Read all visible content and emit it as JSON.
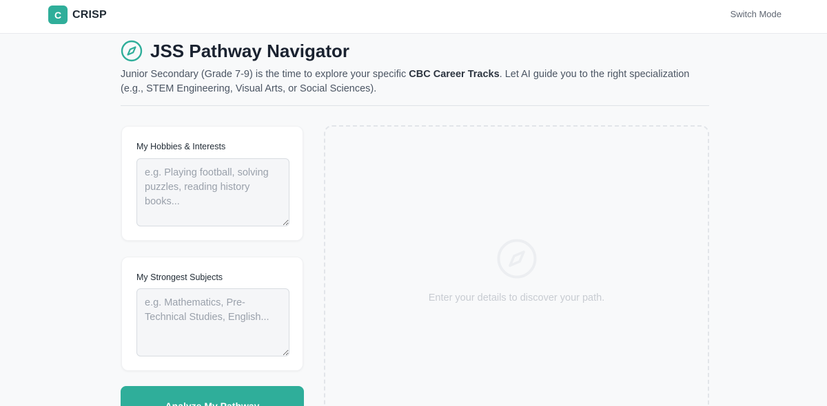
{
  "app": {
    "logo_letter": "C",
    "name": "CRISP",
    "switch_mode_label": "Switch Mode"
  },
  "header": {
    "title": "JSS Pathway Navigator",
    "description_pre": "Junior Secondary (Grade 7-9) is the time to explore your specific ",
    "description_bold": "CBC Career Tracks",
    "description_post": ". Let AI guide you to the right specialization (e.g., STEM Engineering, Visual Arts, or Social Sciences)."
  },
  "form": {
    "hobbies": {
      "label": "My Hobbies & Interests",
      "placeholder": "e.g. Playing football, solving puzzles, reading history books...",
      "value": ""
    },
    "subjects": {
      "label": "My Strongest Subjects",
      "placeholder": "e.g. Mathematics, Pre-Technical Studies, English...",
      "value": ""
    },
    "submit_label": "Analyze My Pathway"
  },
  "result": {
    "empty_icon": "compass-icon",
    "empty_text": "Enter your details to discover your path."
  },
  "colors": {
    "accent": "#2fae9a",
    "title": "#1a2230",
    "muted": "#c8ccd2"
  }
}
